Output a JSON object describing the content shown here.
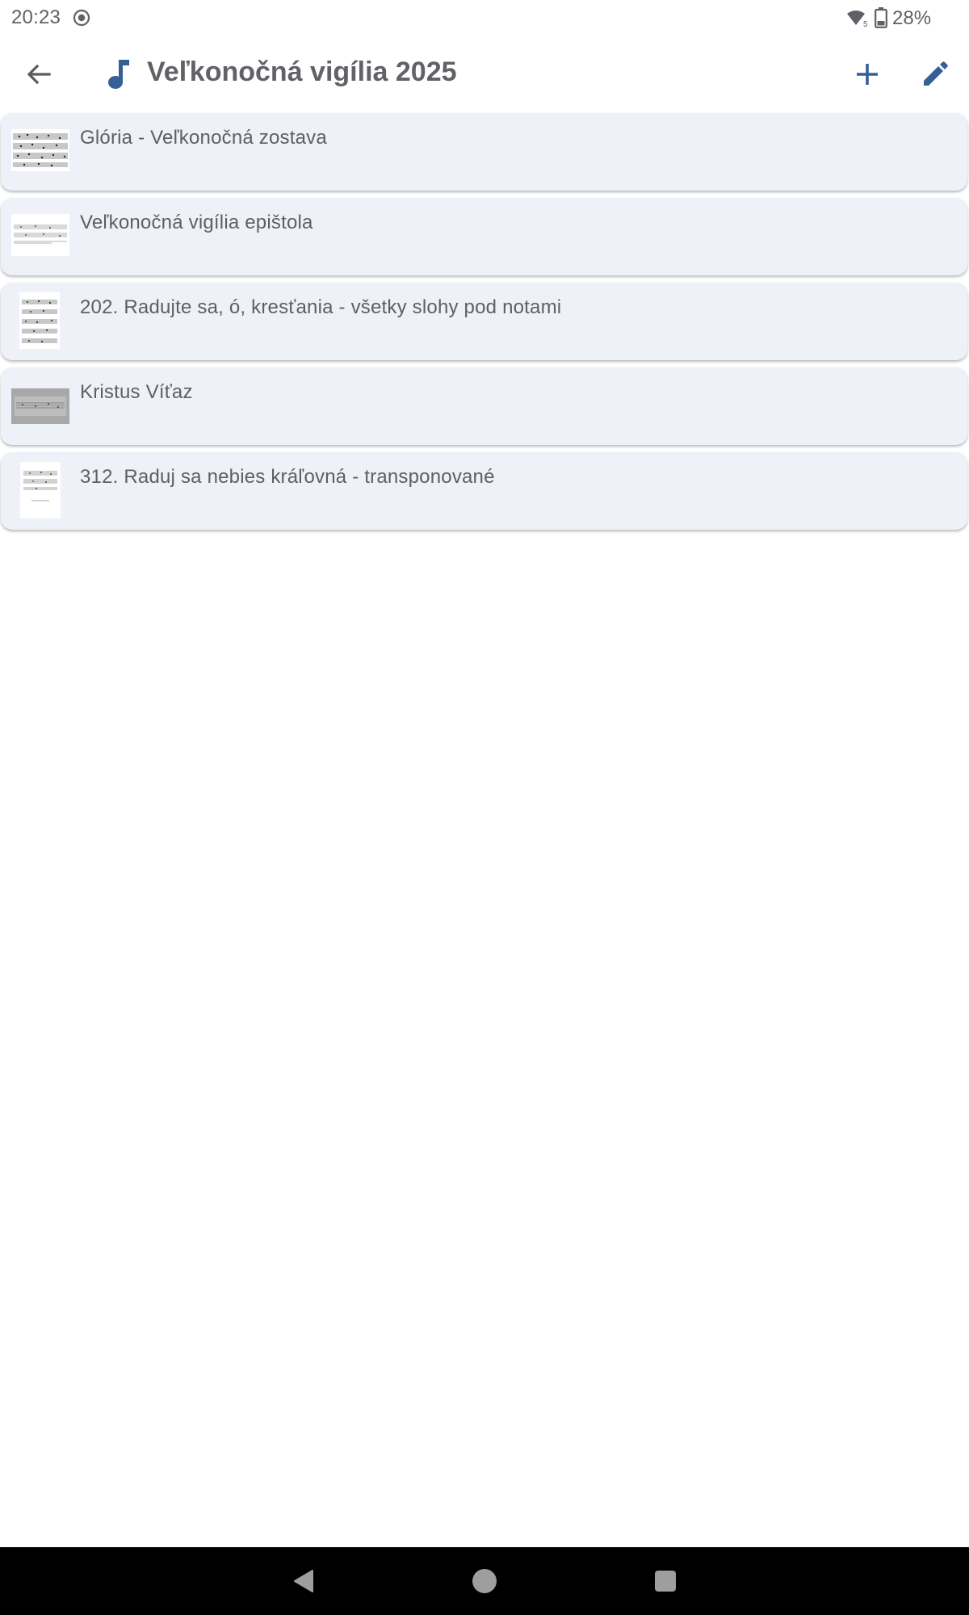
{
  "status_bar": {
    "time": "20:23",
    "battery": "28%",
    "icons": [
      "screen-record-icon",
      "wifi-icon",
      "battery-icon"
    ]
  },
  "app_bar": {
    "title": "Veľkonočná vigília 2025",
    "title_icon": "music-note-icon",
    "actions": [
      "back-arrow-icon",
      "add-icon",
      "edit-pencil-icon"
    ]
  },
  "songs": [
    {
      "title": "Glória - Veľkonočná zostava"
    },
    {
      "title": "Veľkonočná vigília epištola"
    },
    {
      "title": "202. Radujte sa, ó, kresťania - všetky slohy pod notami"
    },
    {
      "title": "Kristus Víťaz"
    },
    {
      "title": "312. Raduj sa nebies kráľovná - transponované"
    }
  ],
  "nav_bar": {
    "icons": [
      "nav-back-icon",
      "nav-home-icon",
      "nav-recents-icon"
    ]
  },
  "colors": {
    "accent": "#355f97",
    "card_bg": "#eff1f8",
    "text": "#5f6166"
  }
}
